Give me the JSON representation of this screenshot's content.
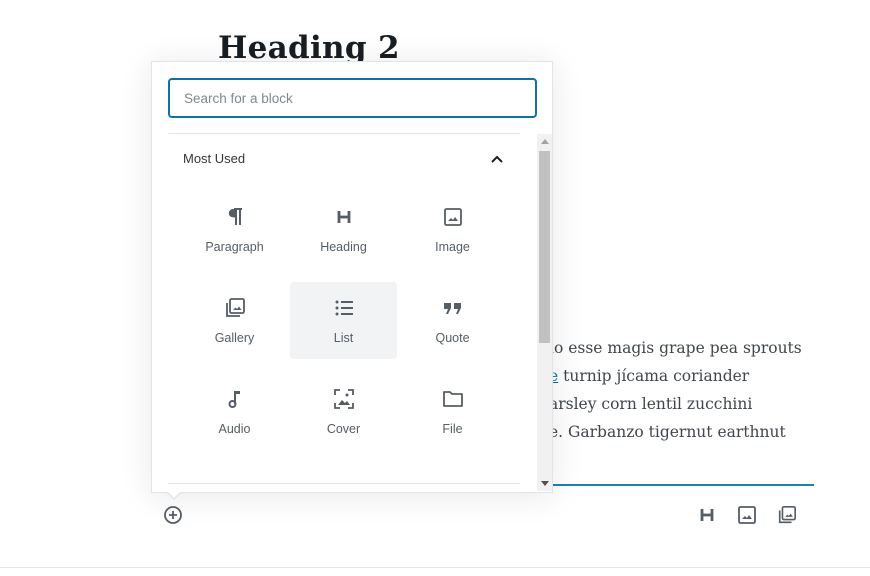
{
  "editor": {
    "heading": "Heading 2",
    "paragraph_lines": [
      "lo esse magis grape pea sprouts",
      "turnip jícama coriander",
      "arsley corn lentil zucchini",
      "e. Garbanzo tigernut earthnut"
    ],
    "paragraph_link_fragment": "e"
  },
  "inserter": {
    "search": {
      "placeholder": "Search for a block",
      "value": ""
    },
    "panel_title": "Most Used",
    "panel_expanded": true,
    "blocks": [
      {
        "label": "Paragraph",
        "icon": "paragraph-icon"
      },
      {
        "label": "Heading",
        "icon": "heading-icon"
      },
      {
        "label": "Image",
        "icon": "image-icon"
      },
      {
        "label": "Gallery",
        "icon": "gallery-icon"
      },
      {
        "label": "List",
        "icon": "list-icon",
        "hovered": true
      },
      {
        "label": "Quote",
        "icon": "quote-icon"
      },
      {
        "label": "Audio",
        "icon": "audio-icon"
      },
      {
        "label": "Cover",
        "icon": "cover-icon"
      },
      {
        "label": "File",
        "icon": "file-icon"
      }
    ]
  },
  "quick_inserter": {
    "buttons": [
      {
        "label": "Heading",
        "icon": "heading-icon"
      },
      {
        "label": "Image",
        "icon": "image-icon"
      },
      {
        "label": "Gallery",
        "icon": "gallery-icon"
      }
    ],
    "add_block_icon": "plus-circle-icon"
  },
  "colors": {
    "accent": "#0e71a8",
    "icon": "#555d66",
    "hover_bg": "#f2f3f5"
  }
}
